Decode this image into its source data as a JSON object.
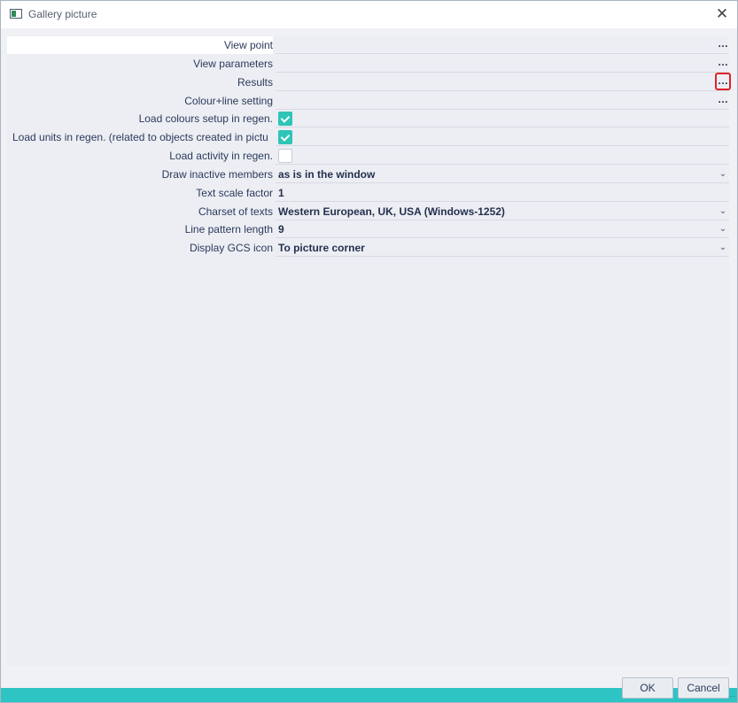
{
  "window": {
    "title": "Gallery picture"
  },
  "properties": [
    {
      "label": "View point",
      "type": "dots",
      "value": ""
    },
    {
      "label": "View parameters",
      "type": "dots",
      "value": ""
    },
    {
      "label": "Results",
      "type": "dots-highlight",
      "value": ""
    },
    {
      "label": "Colour+line setting",
      "type": "dots",
      "value": ""
    },
    {
      "label": "Load colours setup in regen.",
      "type": "checkbox",
      "checked": true
    },
    {
      "label": "Load units in regen. (related to objects created in pictu",
      "type": "checkbox",
      "checked": true
    },
    {
      "label": "Load activity in regen.",
      "type": "checkbox",
      "checked": false
    },
    {
      "label": "Draw inactive members",
      "type": "select",
      "value": "as is in the window"
    },
    {
      "label": "Text scale factor",
      "type": "text",
      "value": "1"
    },
    {
      "label": "Charset of texts",
      "type": "select",
      "value": "Western European, UK, USA (Windows-1252)"
    },
    {
      "label": "Line pattern length",
      "type": "select",
      "value": "9"
    },
    {
      "label": "Display GCS icon",
      "type": "select",
      "value": "To picture corner"
    }
  ],
  "icons": {
    "dots": "…",
    "chevron": "❯",
    "close": "✕"
  },
  "buttons": {
    "ok": "OK",
    "cancel": "Cancel"
  },
  "colors": {
    "accent": "#2ec4c4",
    "checkbox": "#2ec4b6",
    "highlight": "#e0232a"
  }
}
